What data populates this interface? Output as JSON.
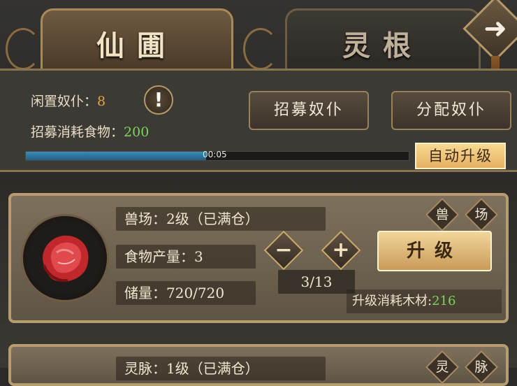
{
  "tabs": [
    {
      "label": "仙圃",
      "active": true
    },
    {
      "label": "灵根",
      "active": false
    }
  ],
  "nav": {
    "next_icon": "arrow-right-icon"
  },
  "status": {
    "idle_servants_label": "闲置奴仆：",
    "idle_servants_value": "8",
    "recruit_cost_label": "招募消耗食物：",
    "recruit_cost_value": "200",
    "alert_icon": "!"
  },
  "buttons": {
    "recruit": "招募奴仆",
    "assign": "分配奴仆",
    "auto_upgrade": "自动升级"
  },
  "progress": {
    "fraction": 0.47,
    "time_text": "00:05"
  },
  "buildings": [
    {
      "name_line": "兽场：2级（已满仓）",
      "output_line": "食物产量：3",
      "storage_line": "储量：720/720",
      "tags": [
        "兽",
        "场"
      ],
      "counter": "3/13",
      "upgrade_label": "升级",
      "cost_label": "升级消耗木材:",
      "cost_value": "216"
    },
    {
      "name_line": "灵脉：1级（已满仓）",
      "tags": [
        "灵",
        "脉"
      ]
    }
  ],
  "colors": {
    "accent_gold": "#e5b163",
    "value_green": "#7fd45c",
    "value_orange": "#e8a248",
    "progress_blue": "#3c8ab6"
  }
}
